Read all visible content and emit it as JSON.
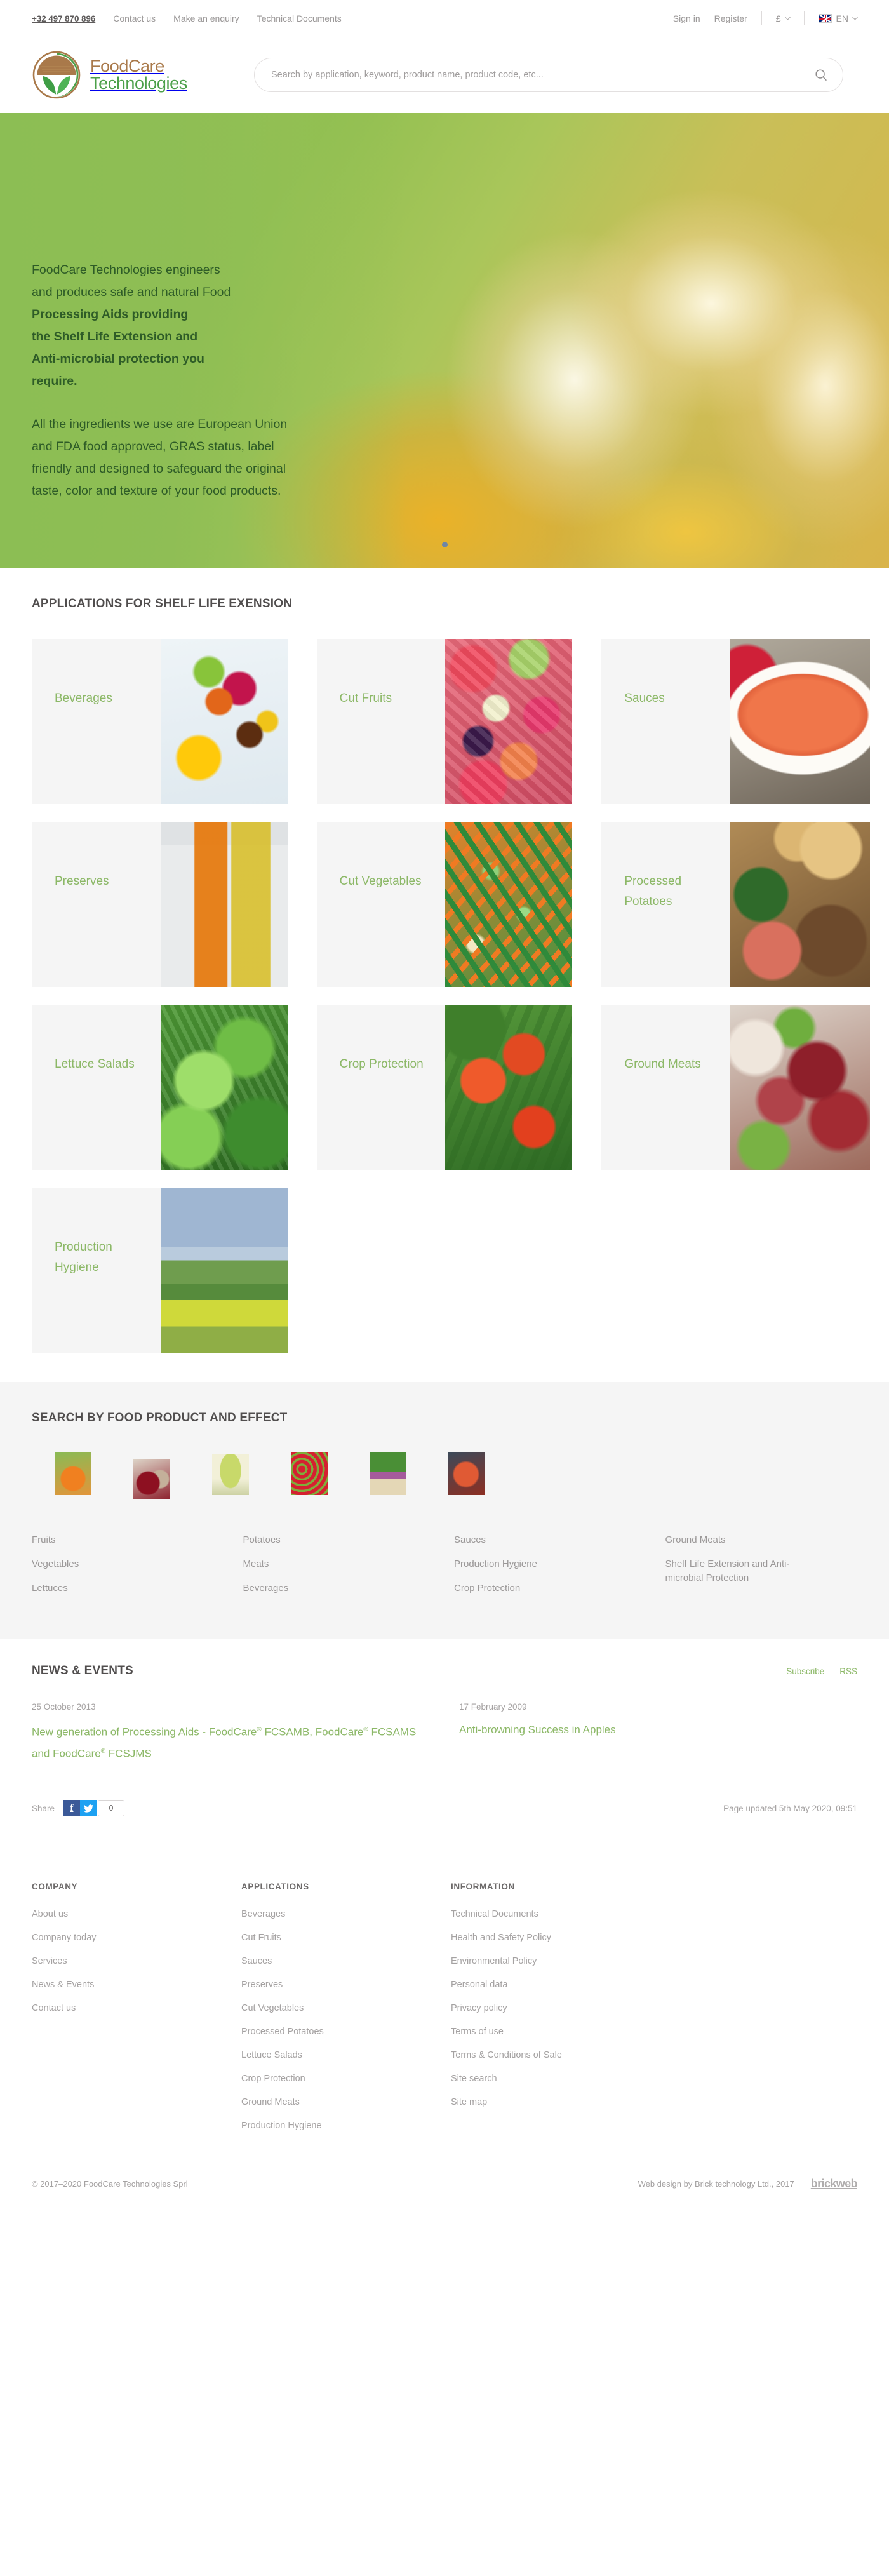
{
  "utility": {
    "phone": "+32 497 870 896",
    "links": [
      {
        "label": "Contact us"
      },
      {
        "label": "Make an enquiry"
      },
      {
        "label": "Technical Documents"
      }
    ],
    "sign_in": "Sign in",
    "register": "Register",
    "currency": "£",
    "language": "EN"
  },
  "brand": {
    "line1": "FoodCare",
    "line2": "Technologies",
    "logo_icon": "leaf-circle-logo"
  },
  "search": {
    "placeholder": "Search by application, keyword, product name, product code, etc...",
    "value": "",
    "icon": "search-icon"
  },
  "hero": {
    "paragraph1_bold_prefix": "FoodCare Technologies engineers and produces safe and natural Food Processing Aids providing ",
    "paragraph1_line1": "FoodCare Technologies engineers",
    "paragraph1_line2": "and produces safe and natural Food",
    "paragraph1_line3": "Processing Aids providing",
    "paragraph1_line4": "the Shelf Life Extension and",
    "paragraph1_line5": "Anti-microbial protection you",
    "paragraph1_line6": "require.",
    "paragraph2": "All the ingredients we use are European Union and FDA food approved, GRAS status, label friendly and designed to safeguard the original taste, color and texture of your food products.",
    "slides": 1
  },
  "applications": {
    "title": "APPLICATIONS FOR SHELF LIFE EXENSION",
    "tiles": [
      {
        "label": "Beverages",
        "image": "ph-beverages",
        "overflow": false
      },
      {
        "label": "Cut Fruits",
        "image": "ph-cutfruits",
        "overflow": false
      },
      {
        "label": "Sauces",
        "image": "ph-sauces",
        "overflow": true
      },
      {
        "label": "Preserves",
        "image": "ph-preserves",
        "overflow": false
      },
      {
        "label": "Cut Vegetables",
        "image": "ph-cutveg",
        "overflow": false
      },
      {
        "label": "Processed Potatoes",
        "image": "ph-potatoes",
        "overflow": true
      },
      {
        "label": "Lettuce Salads",
        "image": "ph-lettuce",
        "overflow": false
      },
      {
        "label": "Crop Protection",
        "image": "ph-crop",
        "overflow": false
      },
      {
        "label": "Ground Meats",
        "image": "ph-meats",
        "overflow": true
      },
      {
        "label": "Production Hygiene",
        "image": "ph-hygiene",
        "overflow": false
      }
    ]
  },
  "byfood": {
    "title": "SEARCH BY FOOD PRODUCT AND EFFECT",
    "thumbs": [
      {
        "name": "juice-glass-thumb",
        "image": "ph-th-juice"
      },
      {
        "name": "bottles-thumb",
        "image": "ph-th-bottles"
      },
      {
        "name": "lettuce-thumb",
        "image": "ph-th-lettuce"
      },
      {
        "name": "berries-basket-thumb",
        "image": "ph-th-berries"
      },
      {
        "name": "vegetables-thumb",
        "image": "ph-th-veg"
      },
      {
        "name": "meat-thumb",
        "image": "ph-th-meat"
      }
    ],
    "columns": [
      {
        "links": [
          "Fruits",
          "Vegetables",
          "Lettuces"
        ]
      },
      {
        "links": [
          "Potatoes",
          "Meats",
          "Beverages"
        ]
      },
      {
        "links": [
          "Sauces",
          "Production Hygiene",
          "Crop Protection"
        ]
      },
      {
        "links": [
          "Ground Meats",
          "Shelf Life Extension and Anti-microbial Protection"
        ]
      }
    ]
  },
  "news": {
    "title": "NEWS & EVENTS",
    "subscribe": "Subscribe",
    "rss": "RSS",
    "items": [
      {
        "date": "25 October 2013",
        "title": "New generation of Processing Aids - FoodCare® FCSAMB, FoodCare® FCSAMS and FoodCare® FCSJMS",
        "image": "ph-news1"
      },
      {
        "date": "17 February 2009",
        "title": "Anti-browning Success in Apples",
        "image": "ph-news2"
      }
    ],
    "share_label": "Share",
    "share_facebook": "f",
    "share_twitter": "t",
    "share_count": "0",
    "page_updated": "Page updated 5th May 2020, 09:51"
  },
  "footer": {
    "columns": [
      {
        "heading": "COMPANY",
        "links": [
          "About us",
          "Company today",
          "Services",
          "News & Events",
          "Contact us"
        ]
      },
      {
        "heading": "APPLICATIONS",
        "links": [
          "Beverages",
          "Cut Fruits",
          "Sauces",
          "Preserves",
          "Cut Vegetables",
          "Processed Potatoes",
          "Lettuce Salads",
          "Crop Protection",
          "Ground Meats",
          "Production Hygiene"
        ]
      },
      {
        "heading": "INFORMATION",
        "links": [
          "Technical Documents",
          "Health and Safety Policy",
          "Environmental Policy",
          "Personal data",
          "Privacy policy",
          "Terms of use",
          "Terms & Conditions of Sale",
          "Site search",
          "Site map"
        ]
      }
    ],
    "copyright": "© 2017–2020  FoodCare Technologies Sprl",
    "webdesign": "Web design by Brick technology Ltd., 2017",
    "webdesign_logo": "brickweb"
  },
  "colors": {
    "green_accent": "#8cb867",
    "brand_brown": "#a9794a",
    "brand_green": "#4ca049",
    "text_muted": "#9b9898",
    "heading": "#514e4e",
    "panel_bg": "#f5f5f5"
  }
}
